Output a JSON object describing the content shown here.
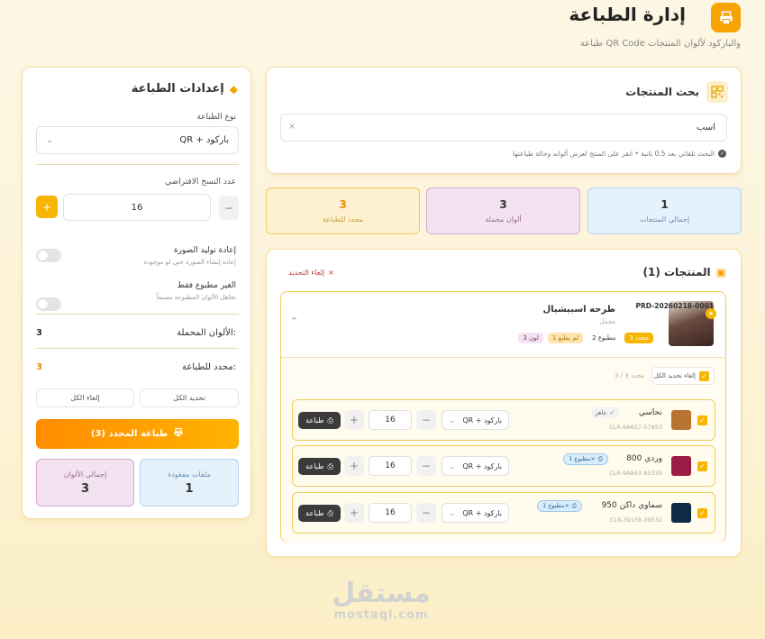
{
  "header": {
    "title": "إدارة الطباعة",
    "subtitle": "طباعة QR Code والباركود لألوان المنتجات"
  },
  "settings": {
    "title": "إعدادات الطباعة",
    "print_type_label": "نوع الطباعة",
    "print_type_value": "QR + باركود",
    "copies_label": "عدد النسخ الافتراضي",
    "copies_value": "16",
    "regen_title": "إعادة توليد الصورة",
    "regen_desc": "إعادة إنشاء الصورة حتى لو موجودة",
    "unprinted_title": "الغير مطبوع فقط",
    "unprinted_desc": "تجاهل الألوان المطبوعة مسبقاً",
    "loaded_label": "الألوان المحملة:",
    "loaded_value": "3",
    "selected_label": "محدد للطباعة:",
    "selected_value": "3",
    "select_all": "تحديد الكل",
    "deselect_all": "إلغاء الكل",
    "print_selected": "طباعة المحدد (3)",
    "stat_total_label": "إجمالي الألوان",
    "stat_total_value": "3",
    "stat_missing_label": "ملفات مفقودة",
    "stat_missing_value": "1"
  },
  "search": {
    "title": "بحث المنتجات",
    "value": "اسب",
    "hint": "البحث تلقائي بعد 0.5 ثانية • انقر على المنتج لعرض ألوانه وحالة طباعتها"
  },
  "stats": [
    {
      "value": "1",
      "label": "إجمالي المنتجات"
    },
    {
      "value": "3",
      "label": "ألوان محملة"
    },
    {
      "value": "3",
      "label": "محدد للطباعة"
    }
  ],
  "products": {
    "title": "المنتجات (1)",
    "clear_selection": "إلغاء التحديد",
    "product": {
      "code": "PRD-20260218-0001",
      "name": "طرحه اسبيشيال",
      "status": "محمل",
      "badge_colors": "3 لون",
      "badge_unprinted": "1 لم يطبع",
      "badge_printed": "2 مطبوع",
      "badge_selected": "3 محدد",
      "deselect_all": "إلغاء تحديد الكل",
      "selected_count": "3 / 3 محدد"
    },
    "rows": [
      {
        "name": "نحاسي",
        "status": "جاهز",
        "code": "CLR-6A657-57853",
        "swatch": "#b87333",
        "type": "QR + باركود",
        "qty": "16",
        "print": "طباعة"
      },
      {
        "name": "وردي 800",
        "status": "مطبوع 1×",
        "code": "CLR-9A843-85339",
        "swatch": "#9b1b45",
        "type": "QR + باركود",
        "qty": "16",
        "print": "طباعة"
      },
      {
        "name": "سماوي داكن 950",
        "status": "مطبوع 1×",
        "code": "CLR-391F8-39532",
        "swatch": "#0e2a44",
        "type": "QR + باركود",
        "qty": "16",
        "print": "طباعة"
      }
    ]
  },
  "watermark": {
    "arabic": "مستقل",
    "latin": "mostaql.com"
  },
  "colors": {
    "accent": "#f7a300",
    "dark": "#3b3b3b",
    "border": "#f2cc5a"
  }
}
